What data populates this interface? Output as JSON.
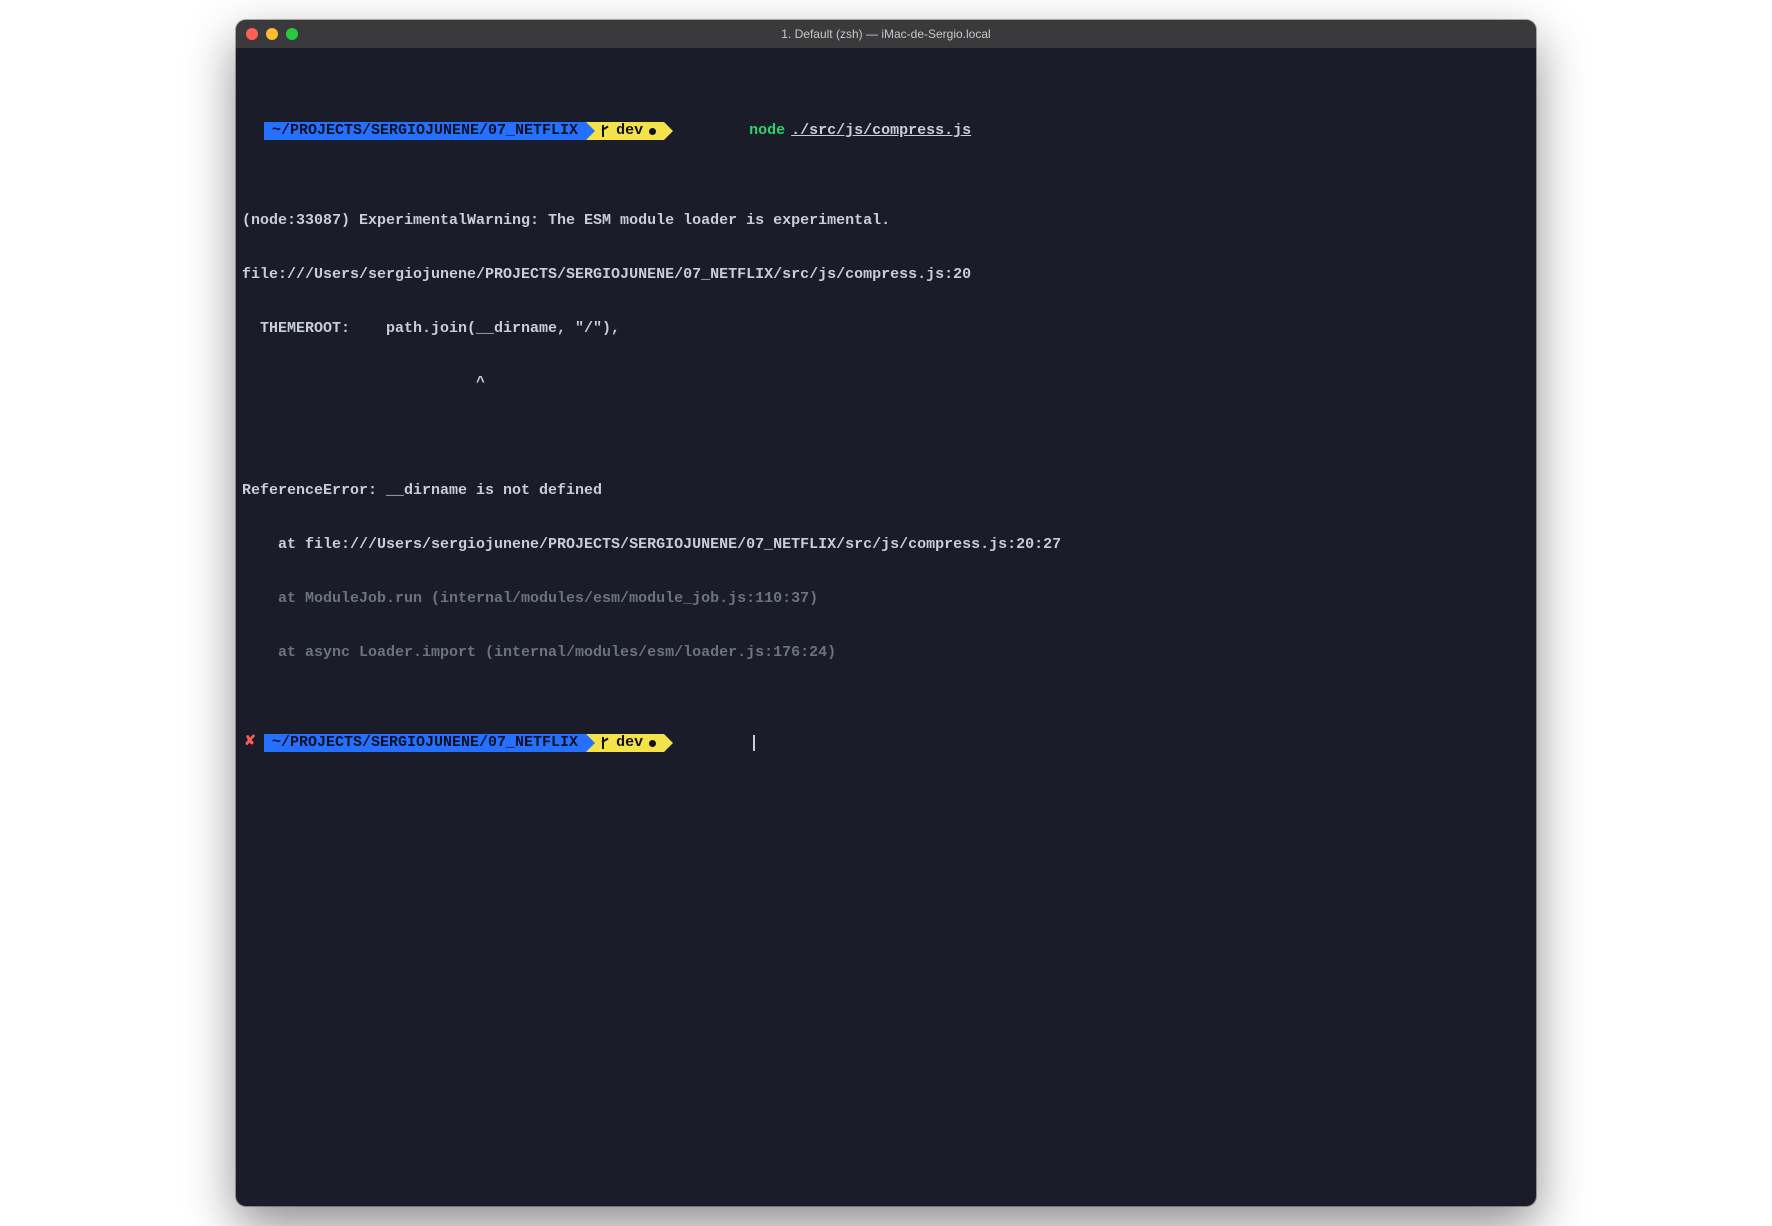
{
  "window": {
    "title": "1. Default (zsh) — iMac-de-Sergio.local"
  },
  "prompt1": {
    "status": "",
    "path": "~/PROJECTS/SERGIOJUNENE/07_NETFLIX",
    "branch": "dev",
    "cmd_bin": "node",
    "cmd_arg": "./src/js/compress.js"
  },
  "output": {
    "l1": "(node:33087) ExperimentalWarning: The ESM module loader is experimental.",
    "l2": "file:///Users/sergiojunene/PROJECTS/SERGIOJUNENE/07_NETFLIX/src/js/compress.js:20",
    "l3": "  THEMEROOT:    path.join(__dirname, \"/\"),",
    "l4": "                          ^",
    "l5": "",
    "l6": "ReferenceError: __dirname is not defined",
    "l7": "    at file:///Users/sergiojunene/PROJECTS/SERGIOJUNENE/07_NETFLIX/src/js/compress.js:20:27",
    "l8": "    at ModuleJob.run (internal/modules/esm/module_job.js:110:37)",
    "l9": "    at async Loader.import (internal/modules/esm/loader.js:176:24)"
  },
  "prompt2": {
    "status": "✘",
    "path": "~/PROJECTS/SERGIOJUNENE/07_NETFLIX",
    "branch": "dev"
  }
}
